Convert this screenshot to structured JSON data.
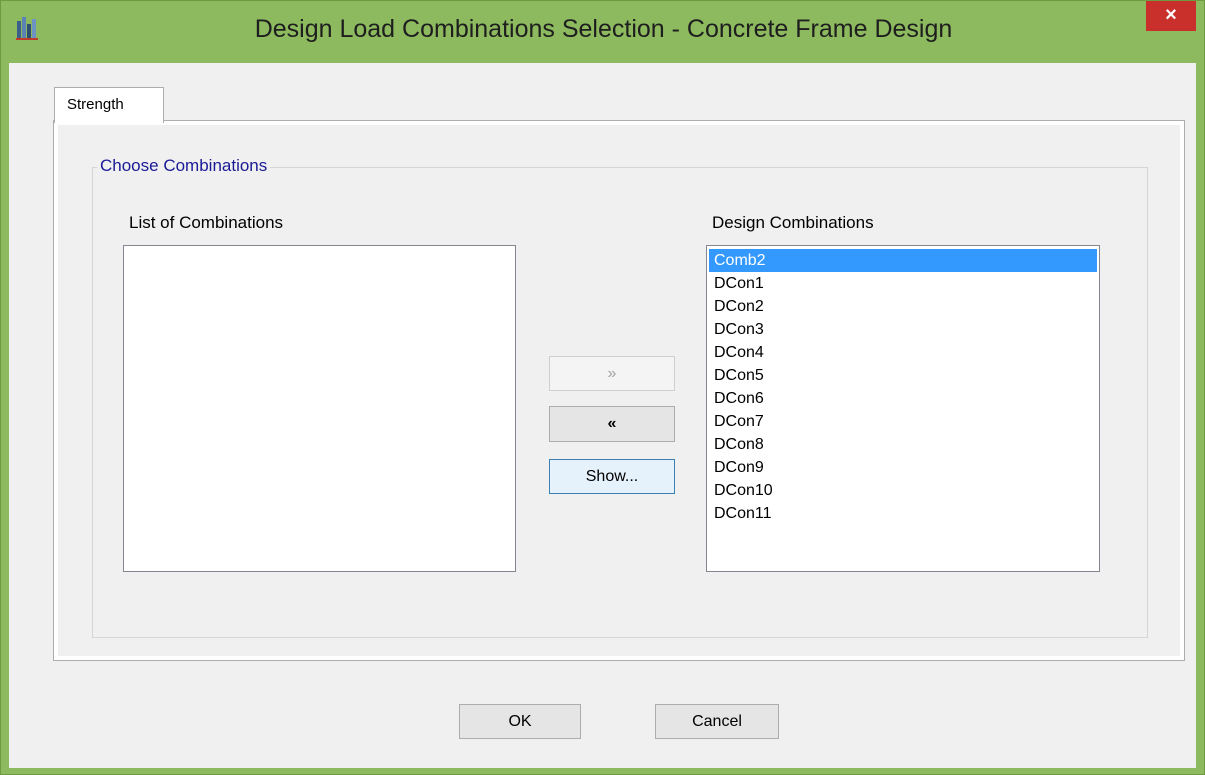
{
  "window": {
    "title": "Design Load Combinations Selection - Concrete Frame Design",
    "close_glyph": "×",
    "app_icon": "etabs-building-icon"
  },
  "tabs": [
    {
      "label": "Strength",
      "active": true
    }
  ],
  "group": {
    "label": "Choose Combinations"
  },
  "available": {
    "caption": "List of Combinations",
    "items": []
  },
  "design": {
    "caption": "Design Combinations",
    "items": [
      "Comb2",
      "DCon1",
      "DCon2",
      "DCon3",
      "DCon4",
      "DCon5",
      "DCon6",
      "DCon7",
      "DCon8",
      "DCon9",
      "DCon10",
      "DCon11"
    ],
    "selected_index": 0
  },
  "buttons": {
    "add_label": "»",
    "remove_label": "«",
    "show_label": "Show...",
    "ok_label": "OK",
    "cancel_label": "Cancel"
  },
  "colors": {
    "frame": "#8dba5f",
    "close": "#c9302c",
    "selection": "#3399ff",
    "group_label": "#1a1a96"
  }
}
